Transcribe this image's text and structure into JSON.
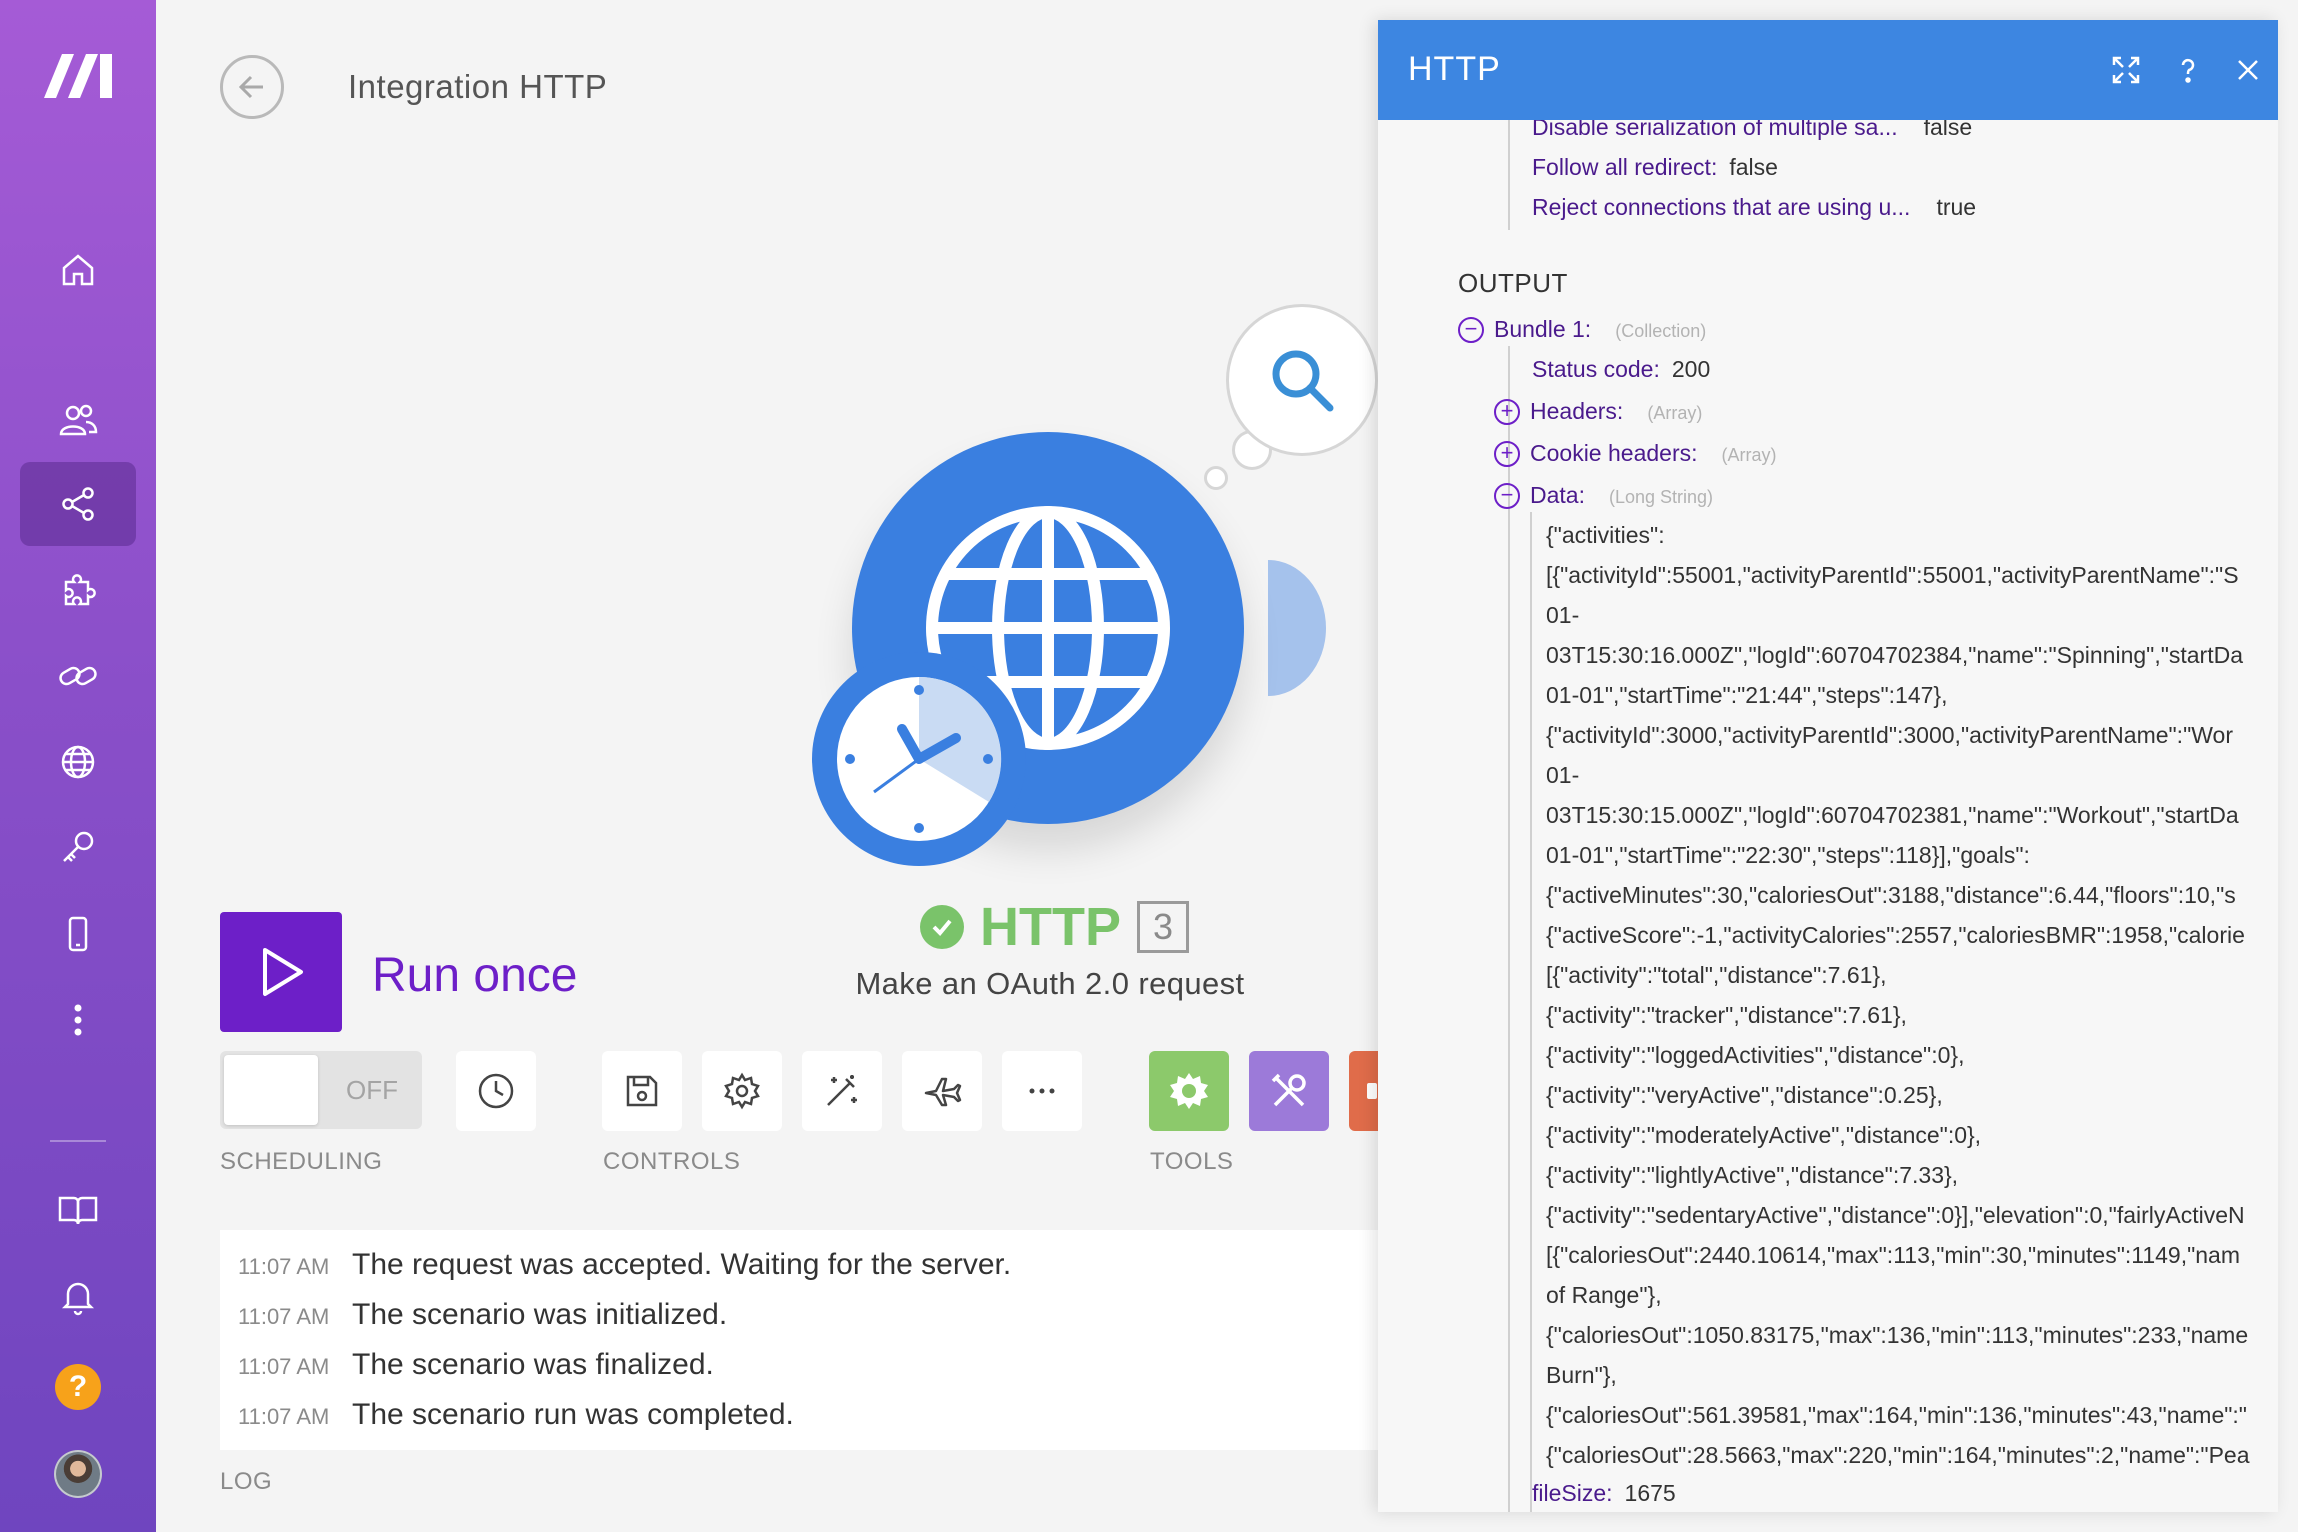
{
  "header": {
    "title": "Integration HTTP"
  },
  "sidebar": {
    "items": [
      {
        "icon": "home-icon"
      },
      {
        "icon": "team-icon"
      },
      {
        "icon": "scenarios-icon",
        "active": true
      },
      {
        "icon": "apps-icon"
      },
      {
        "icon": "connections-icon"
      },
      {
        "icon": "webhooks-icon"
      },
      {
        "icon": "keys-icon"
      },
      {
        "icon": "devices-icon"
      },
      {
        "icon": "more-icon"
      }
    ],
    "help_label": "?"
  },
  "module": {
    "name": "HTTP",
    "badge": "3",
    "subtitle": "Make an OAuth 2.0 request"
  },
  "run": {
    "label": "Run once"
  },
  "scheduling": {
    "toggle_state": "OFF",
    "label": "SCHEDULING"
  },
  "controls": {
    "label": "CONTROLS"
  },
  "tools": {
    "label": "TOOLS"
  },
  "log": {
    "label": "LOG",
    "entries": [
      {
        "time": "11:07 AM",
        "text": "The request was accepted. Waiting for the server."
      },
      {
        "time": "11:07 AM",
        "text": "The scenario was initialized."
      },
      {
        "time": "11:07 AM",
        "text": "The scenario was finalized."
      },
      {
        "time": "11:07 AM",
        "text": "The scenario run was completed."
      }
    ]
  },
  "panel": {
    "title": "HTTP",
    "input_rows": [
      {
        "key": "Disable serialization of multiple sa...",
        "value": "false"
      },
      {
        "key": "Follow all redirect:",
        "value": "false"
      },
      {
        "key": "Reject connections that are using u...",
        "value": "true"
      }
    ],
    "output_label": "OUTPUT",
    "bundle": {
      "key": "Bundle 1:",
      "type": "(Collection)",
      "toggle": "−"
    },
    "status": {
      "key": "Status code:",
      "value": "200"
    },
    "headers": {
      "key": "Headers:",
      "type": "(Array)",
      "toggle": "+"
    },
    "cookie_headers": {
      "key": "Cookie headers:",
      "type": "(Array)",
      "toggle": "+"
    },
    "data": {
      "key": "Data:",
      "type": "(Long String)",
      "toggle": "−"
    },
    "data_lines": [
      "{\"activities\":",
      "[{\"activityId\":55001,\"activityParentId\":55001,\"activityParentName\":\"S",
      "01-",
      "03T15:30:16.000Z\",\"logId\":60704702384,\"name\":\"Spinning\",\"startDa",
      "01-01\",\"startTime\":\"21:44\",\"steps\":147},",
      "{\"activityId\":3000,\"activityParentId\":3000,\"activityParentName\":\"Wor",
      "01-",
      "03T15:30:15.000Z\",\"logId\":60704702381,\"name\":\"Workout\",\"startDa",
      "01-01\",\"startTime\":\"22:30\",\"steps\":118}],\"goals\":",
      "{\"activeMinutes\":30,\"caloriesOut\":3188,\"distance\":6.44,\"floors\":10,\"s",
      "{\"activeScore\":-1,\"activityCalories\":2557,\"caloriesBMR\":1958,\"calorie",
      "[{\"activity\":\"total\",\"distance\":7.61},",
      "{\"activity\":\"tracker\",\"distance\":7.61},",
      "{\"activity\":\"loggedActivities\",\"distance\":0},",
      "{\"activity\":\"veryActive\",\"distance\":0.25},",
      "{\"activity\":\"moderatelyActive\",\"distance\":0},",
      "{\"activity\":\"lightlyActive\",\"distance\":7.33},",
      "{\"activity\":\"sedentaryActive\",\"distance\":0}],\"elevation\":0,\"fairlyActiveN",
      "[{\"caloriesOut\":2440.10614,\"max\":113,\"min\":30,\"minutes\":1149,\"nam",
      "of Range\"},",
      "{\"caloriesOut\":1050.83175,\"max\":136,\"min\":113,\"minutes\":233,\"name",
      "Burn\"},",
      "{\"caloriesOut\":561.39581,\"max\":164,\"min\":136,\"minutes\":43,\"name\":\"",
      "{\"caloriesOut\":28.5663,\"max\":220,\"min\":164,\"minutes\":2,\"name\":\"Pea"
    ],
    "file_size": {
      "key": "fileSize:",
      "value": "1675"
    }
  },
  "colors": {
    "brand_purple": "#6d1fc8",
    "panel_header": "#3d86e1",
    "module_blue": "#3a7fe0",
    "success_green": "#7ac36a"
  }
}
